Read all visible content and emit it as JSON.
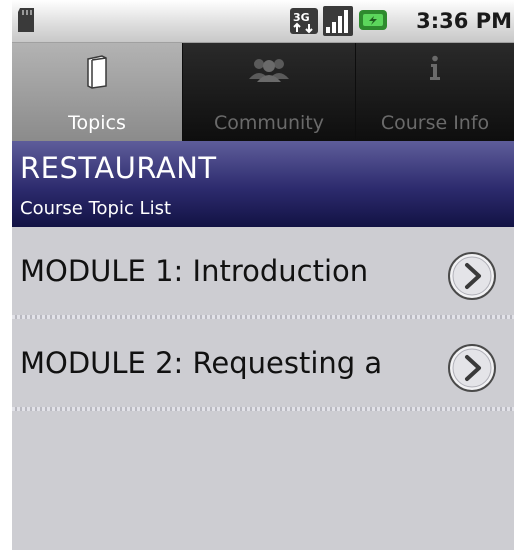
{
  "status_bar": {
    "time": "3:36 PM",
    "network_label": "3G",
    "icons": [
      "sd-card-icon",
      "network-3g-icon",
      "signal-icon",
      "battery-icon"
    ]
  },
  "tabs": [
    {
      "label": "Topics",
      "icon": "book-icon",
      "selected": true
    },
    {
      "label": "Community",
      "icon": "people-icon",
      "selected": false
    },
    {
      "label": "Course Info",
      "icon": "info-icon",
      "selected": false
    }
  ],
  "header": {
    "title": "RESTAURANT",
    "subtitle": "Course Topic List"
  },
  "topics": [
    {
      "label": "MODULE 1: Introduction",
      "icon": "chevron-right-icon"
    },
    {
      "label": "MODULE 2: Requesting a",
      "icon": "chevron-right-icon"
    }
  ],
  "colors": {
    "header_top": "#5e5d9a",
    "header_bottom": "#121244",
    "list_background": "#cdcdd2",
    "tab_selected": "#9f9f9f"
  }
}
